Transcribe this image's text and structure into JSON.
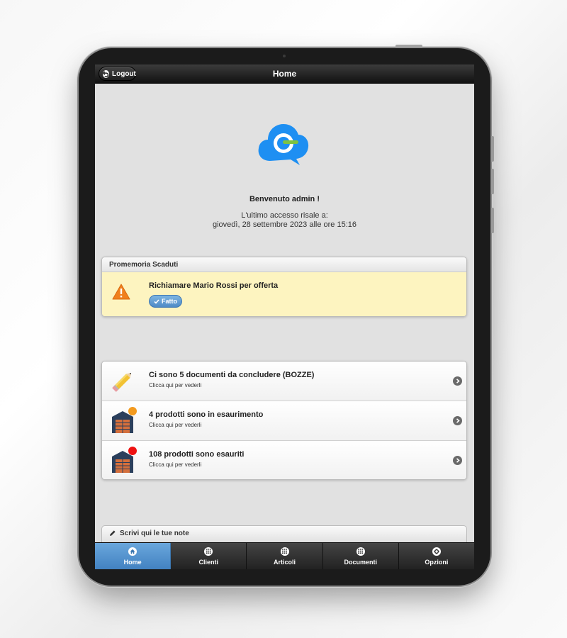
{
  "header": {
    "title": "Home",
    "logout_label": "Logout"
  },
  "welcome": {
    "greeting": "Benvenuto admin !",
    "last_access_line1": "L'ultimo accesso risale a:",
    "last_access_line2": "giovedì, 28 settembre 2023 alle ore 15:16"
  },
  "reminders": {
    "title": "Promemoria Scaduti",
    "items": [
      {
        "text": "Richiamare Mario Rossi per offerta",
        "button": "Fatto"
      }
    ]
  },
  "list": {
    "items": [
      {
        "title": "Ci sono 5 documenti da concludere (BOZZE)",
        "subtitle": "Clicca qui per vederli",
        "icon": "pencil-icon"
      },
      {
        "title": "4 prodotti sono in esaurimento",
        "subtitle": "Clicca qui per vederli",
        "icon": "warehouse-icon",
        "badge_color": "#f39a1e"
      },
      {
        "title": "108 prodotti sono esauriti",
        "subtitle": "Clicca qui per vederli",
        "icon": "warehouse-icon",
        "badge_color": "#ee1111"
      }
    ]
  },
  "notes": {
    "label": "Scrivi qui le tue note"
  },
  "footer": {
    "tabs": [
      {
        "label": "Home",
        "icon": "home-icon",
        "active": true
      },
      {
        "label": "Clienti",
        "icon": "grid-icon",
        "active": false
      },
      {
        "label": "Articoli",
        "icon": "grid-icon",
        "active": false
      },
      {
        "label": "Documenti",
        "icon": "grid-icon",
        "active": false
      },
      {
        "label": "Opzioni",
        "icon": "gear-icon",
        "active": false
      }
    ]
  },
  "colors": {
    "accent": "#4d8ac6",
    "logo_blue": "#1e8ff2",
    "logo_green": "#7cc242",
    "reminder_bg": "#fdf4c0",
    "warning_orange": "#f0801e"
  }
}
